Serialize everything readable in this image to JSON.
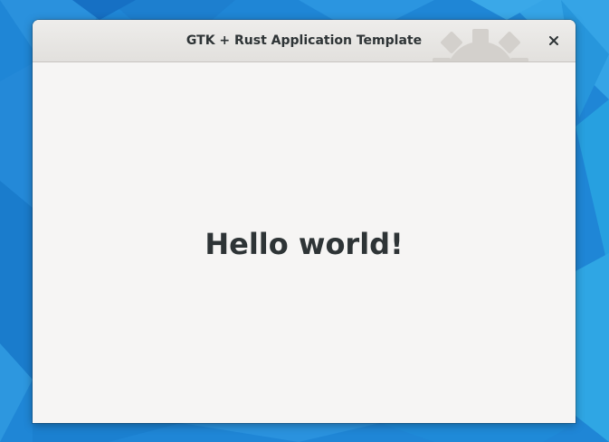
{
  "window": {
    "title": "GTK + Rust Application Template",
    "close_icon": "close-icon"
  },
  "main": {
    "label": "Hello world!"
  },
  "colors": {
    "wallpaper": "#1f86d6",
    "window_bg": "#f6f5f4",
    "text": "#2e3436"
  }
}
